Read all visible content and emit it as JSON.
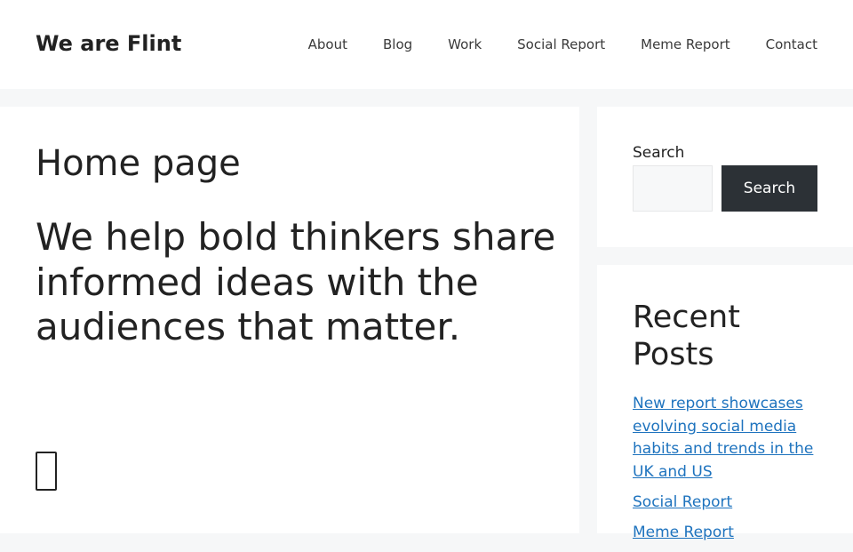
{
  "header": {
    "site_title": "We are Flint",
    "nav": [
      "About",
      "Blog",
      "Work",
      "Social Report",
      "Meme Report",
      "Contact"
    ]
  },
  "main": {
    "title": "Home page",
    "tagline": "We help bold thinkers share informed ideas with the audiences that matter."
  },
  "sidebar": {
    "search": {
      "label": "Search",
      "button_label": "Search",
      "placeholder": ""
    },
    "recent_posts": {
      "title": "Recent Posts",
      "items": [
        "New report showcases evolving social media habits and trends in the UK and US",
        "Social Report",
        "Meme Report"
      ]
    }
  },
  "colors": {
    "link": "#1e73be",
    "button_bg": "#2c3136",
    "page_bg": "#f6f7f8"
  }
}
